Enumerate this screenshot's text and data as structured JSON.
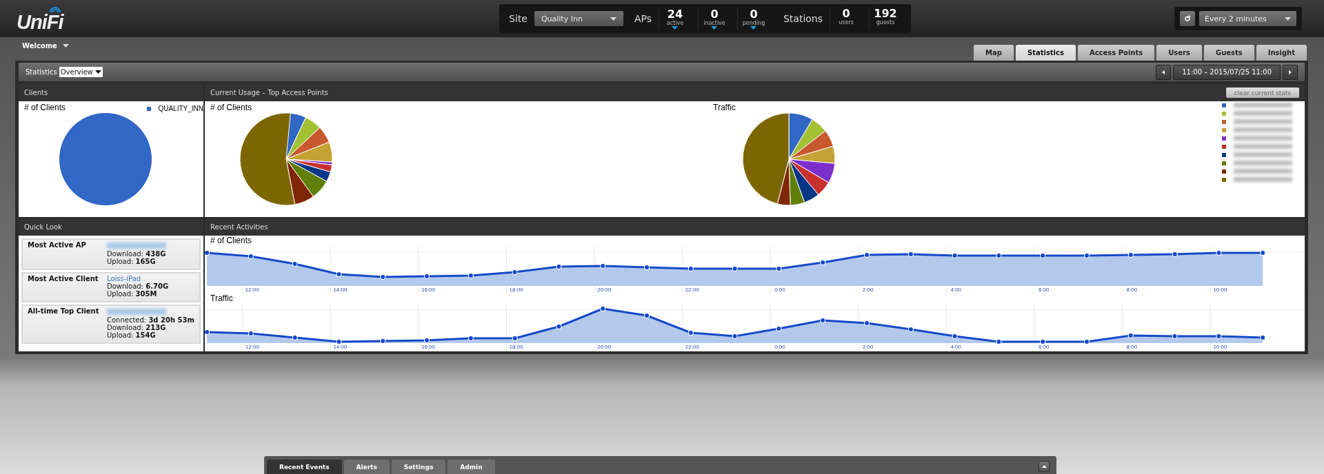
{
  "header": {
    "logo": "UniFi",
    "site_label": "Site",
    "site_value": "Quality Inn",
    "aps_label": "APs",
    "ap_stats": [
      {
        "value": "24",
        "label": "active"
      },
      {
        "value": "0",
        "label": "inactive"
      },
      {
        "value": "0",
        "label": "pending"
      }
    ],
    "stations_label": "Stations",
    "station_stats": [
      {
        "value": "0",
        "label": "users"
      },
      {
        "value": "192",
        "label": "guests"
      }
    ],
    "refresh": "Every 2 minutes"
  },
  "welcome": "Welcome",
  "tabs": [
    {
      "label": "Map",
      "selected": false
    },
    {
      "label": "Statistics",
      "selected": true
    },
    {
      "label": "Access Points",
      "selected": false
    },
    {
      "label": "Users",
      "selected": false
    },
    {
      "label": "Guests",
      "selected": false
    },
    {
      "label": "Insight",
      "selected": false
    }
  ],
  "toolbar": {
    "label": "Statistics",
    "view": "Overview",
    "range": "11:00 – 2015/07/25 11:00"
  },
  "clients_panel": {
    "title": "Clients",
    "chart_title": "# of Clients",
    "legend": "QUALITY_INN",
    "color": "#3167c5"
  },
  "usage_panel": {
    "title": "Current Usage – Top Access Points",
    "button": "clear current stats",
    "chart_titles": [
      "# of Clients",
      "Traffic"
    ],
    "legend": [
      {
        "color": "#3167c5"
      },
      {
        "color": "#a4c034"
      },
      {
        "color": "#c8582e"
      },
      {
        "color": "#c4a234"
      },
      {
        "color": "#7b2fcb"
      },
      {
        "color": "#c8302f"
      },
      {
        "color": "#073686"
      },
      {
        "color": "#5f7f06"
      },
      {
        "color": "#7f2607"
      },
      {
        "color": "#7d6600"
      }
    ]
  },
  "quick_look": {
    "title": "Quick Look",
    "items": [
      {
        "label": "Most Active AP",
        "lines": [
          {
            "key": "Download:",
            "value": "438G"
          },
          {
            "key": "Upload:",
            "value": "165G"
          }
        ]
      },
      {
        "label": "Most Active Client",
        "link": "Loiss-iPad",
        "lines": [
          {
            "key": "Download:",
            "value": "6.70G"
          },
          {
            "key": "Upload:",
            "value": "305M"
          }
        ]
      },
      {
        "label": "All-time Top Client",
        "lines": [
          {
            "key": "Connected:",
            "value": "3d 20h 53m"
          },
          {
            "key": "Download:",
            "value": "213G"
          },
          {
            "key": "Upload:",
            "value": "154G"
          }
        ]
      }
    ]
  },
  "activities": {
    "title": "Recent Activities",
    "charts": [
      {
        "title": "# of Clients",
        "x_labels": [
          "12:00",
          "14:00",
          "16:00",
          "18:00",
          "20:00",
          "22:00",
          "0:00",
          "2:00",
          "4:00",
          "6:00",
          "8:00",
          "10:00"
        ]
      },
      {
        "title": "Traffic",
        "x_labels": [
          "12:00",
          "14:00",
          "16:00",
          "18:00",
          "20:00",
          "22:00",
          "0:00",
          "2:00",
          "4:00",
          "6:00",
          "8:00",
          "10:00"
        ]
      }
    ]
  },
  "bottom_tabs": [
    {
      "label": "Recent Events",
      "selected": true
    },
    {
      "label": "Alerts",
      "selected": false
    },
    {
      "label": "Settings",
      "selected": false
    },
    {
      "label": "Admin",
      "selected": false
    }
  ]
}
